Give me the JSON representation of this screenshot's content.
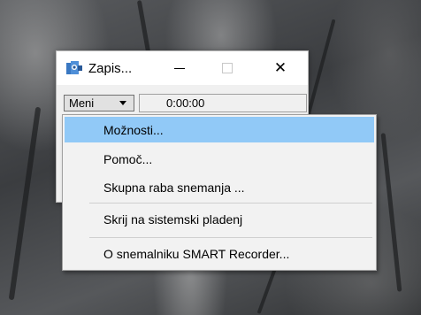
{
  "window": {
    "title": "Zapis...",
    "minimize_icon": "minimize-icon",
    "maximize_icon": "maximize-icon",
    "close_glyph": "✕",
    "close_icon": "close-icon"
  },
  "toolbar": {
    "menu_label": "Meni",
    "timer_value": "0:00:00"
  },
  "menu": {
    "items": [
      {
        "label": "Možnosti...",
        "highlighted": true
      },
      {
        "label": "Pomoč...",
        "highlighted": false
      },
      {
        "label": "Skupna raba snemanja ...",
        "highlighted": false
      },
      {
        "label": "Skrij na sistemski pladenj",
        "highlighted": false
      },
      {
        "label": "O snemalniku SMART Recorder...",
        "highlighted": false
      }
    ]
  },
  "colors": {
    "highlight": "#91c9f7",
    "menu_bg": "#f2f2f2",
    "window_bg": "#f0f0f0"
  }
}
